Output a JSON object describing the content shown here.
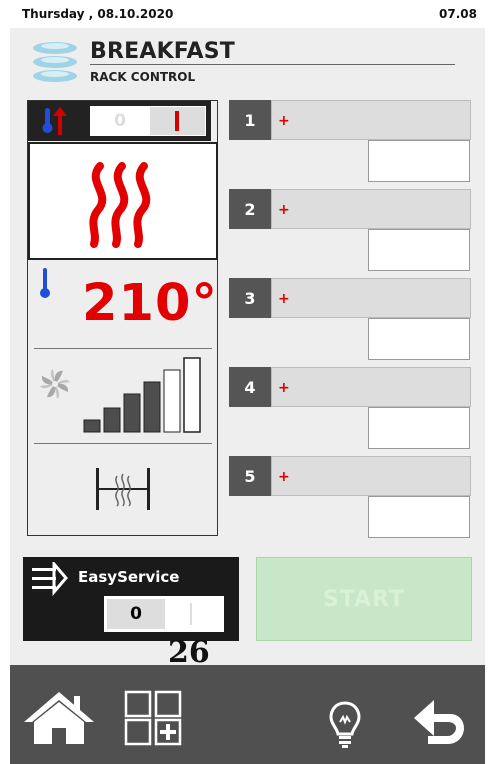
{
  "status": {
    "date": "Thursday , 08.10.2020",
    "time": "07.08"
  },
  "program": {
    "title": "BREAKFAST",
    "subtitle": "RACK CONTROL",
    "icon": "stacked-plates-icon"
  },
  "oven": {
    "preheat_toggle": {
      "off_label": "0",
      "on_label": "I",
      "state": "on"
    },
    "heat_mode_icon": "heating-waves-icon",
    "temperature": "210°",
    "fan_speed": {
      "level": 4,
      "max": 5
    },
    "humidity_icon": "moisture-damper-icon"
  },
  "racks": [
    {
      "number": "1",
      "plus": "+"
    },
    {
      "number": "2",
      "plus": "+"
    },
    {
      "number": "3",
      "plus": "+"
    },
    {
      "number": "4",
      "plus": "+"
    },
    {
      "number": "5",
      "plus": "+"
    }
  ],
  "easyservice": {
    "label": "EasyService",
    "off_label": "0",
    "on_label": "I",
    "state": "off"
  },
  "counter": "26",
  "start_label": "START",
  "nav": {
    "home": "home-icon",
    "add": "grid-add-icon",
    "tip": "lightbulb-icon",
    "back": "back-arrow-icon"
  },
  "colors": {
    "accent_red": "#e30000",
    "dark": "#222222",
    "start_disabled": "#c8e6c8",
    "nav_bar": "#505050"
  }
}
